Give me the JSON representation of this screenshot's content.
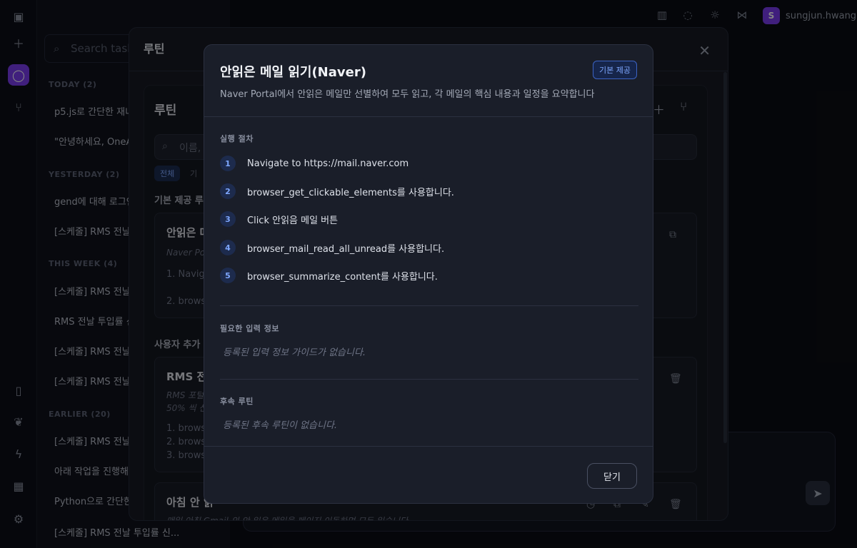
{
  "sidebar": {
    "search_placeholder": "Search tasks",
    "groups": [
      {
        "label": "TODAY (2)",
        "items": [
          "p5.js로 간단한 재녀",
          "\"안녕하세요, OneA"
        ]
      },
      {
        "label": "YESTERDAY (2)",
        "items": [
          "gend에 대해 로그인",
          "[스케줄] RMS 전날"
        ]
      },
      {
        "label": "THIS WEEK (4)",
        "items": [
          "[스케줄] RMS 전날",
          "RMS 전날 투입률 신",
          "[스케줄] RMS 전날",
          "[스케줄] RMS 전날"
        ]
      },
      {
        "label": "EARLIER (20)",
        "items": [
          "[스케줄] RMS 전날",
          "아래 작업을 진행해주",
          "Python으로 간단한",
          "[스케줄] RMS 전날 투입률 신..."
        ]
      }
    ]
  },
  "user": {
    "initial": "S",
    "name": "sungjun.hwang"
  },
  "routine_modal": {
    "title": "루틴",
    "inner_title": "루틴",
    "search_placeholder": "이름, 설",
    "chips": [
      "전체",
      "기"
    ],
    "section_builtin": "기본 제공 루틴",
    "section_custom": "사용자 추가 루",
    "cards": [
      {
        "title": "안읽은 메",
        "desc": "Naver Port",
        "steps": [
          "1. Naviga",
          "2. brows"
        ]
      },
      {
        "title": "RMS 전날",
        "desc": "RMS 포털",
        "desc2": "50% 씩 신",
        "steps": [
          "1. browse",
          "2. brows",
          "3. brows"
        ]
      },
      {
        "title": "아침 안 읽",
        "desc": "매일 아침 Gmail 의 안 읽은 메일을 페이지 이동하며 모두 읽습니다",
        "steps": []
      }
    ]
  },
  "detail": {
    "title": "안읽은 메일 읽기(Naver)",
    "badge": "기본 제공",
    "description": "Naver Portal에서 안읽은 메일만 선별하여 모두 읽고, 각 메일의 핵심 내용과 일정을 요약합니다",
    "steps_label": "실행 절차",
    "steps": [
      {
        "n": "1",
        "text": "Navigate to https://mail.naver.com"
      },
      {
        "n": "2",
        "text": "browser_get_clickable_elements를 사용합니다."
      },
      {
        "n": "3",
        "text": "Click 안읽음 메일 버튼"
      },
      {
        "n": "4",
        "text": "browser_mail_read_all_unread를 사용합니다."
      },
      {
        "n": "5",
        "text": "browser_summarize_content를 사용합니다."
      }
    ],
    "inputs_label": "필요한 입력 정보",
    "inputs_empty": "등록된 입력 정보 가이드가 없습니다.",
    "followup_label": "후속 루틴",
    "followup_empty": "등록된 후속 루틴이 없습니다.",
    "close_label": "닫기"
  }
}
